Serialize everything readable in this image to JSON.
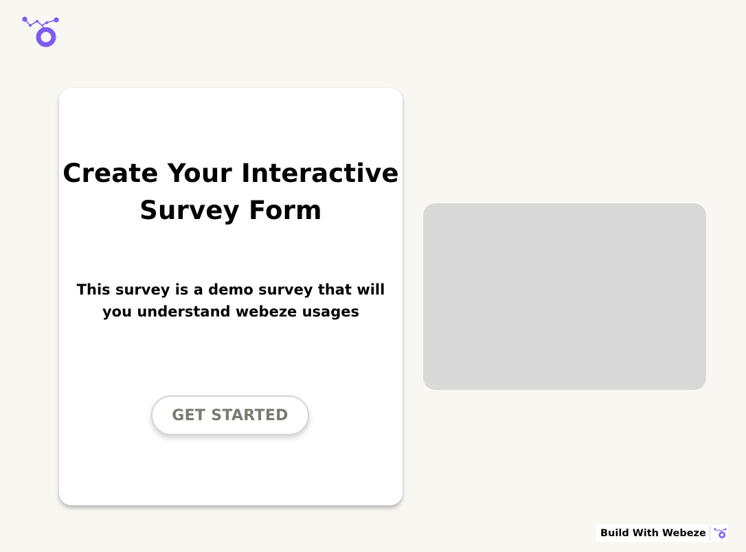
{
  "app": {
    "logo_icon": "webeze-logo-icon",
    "accent_color": "#7c5cf4"
  },
  "hero": {
    "title": "Create Your Interactive Survey Form",
    "subtitle": "This survey is a demo survey that will you understand webeze usages",
    "cta_label": "GET STARTED"
  },
  "media": {
    "placeholder_color": "#d9d9d9"
  },
  "footer": {
    "badge_label": "Build With Webeze",
    "badge_icon": "webeze-logo-icon"
  }
}
